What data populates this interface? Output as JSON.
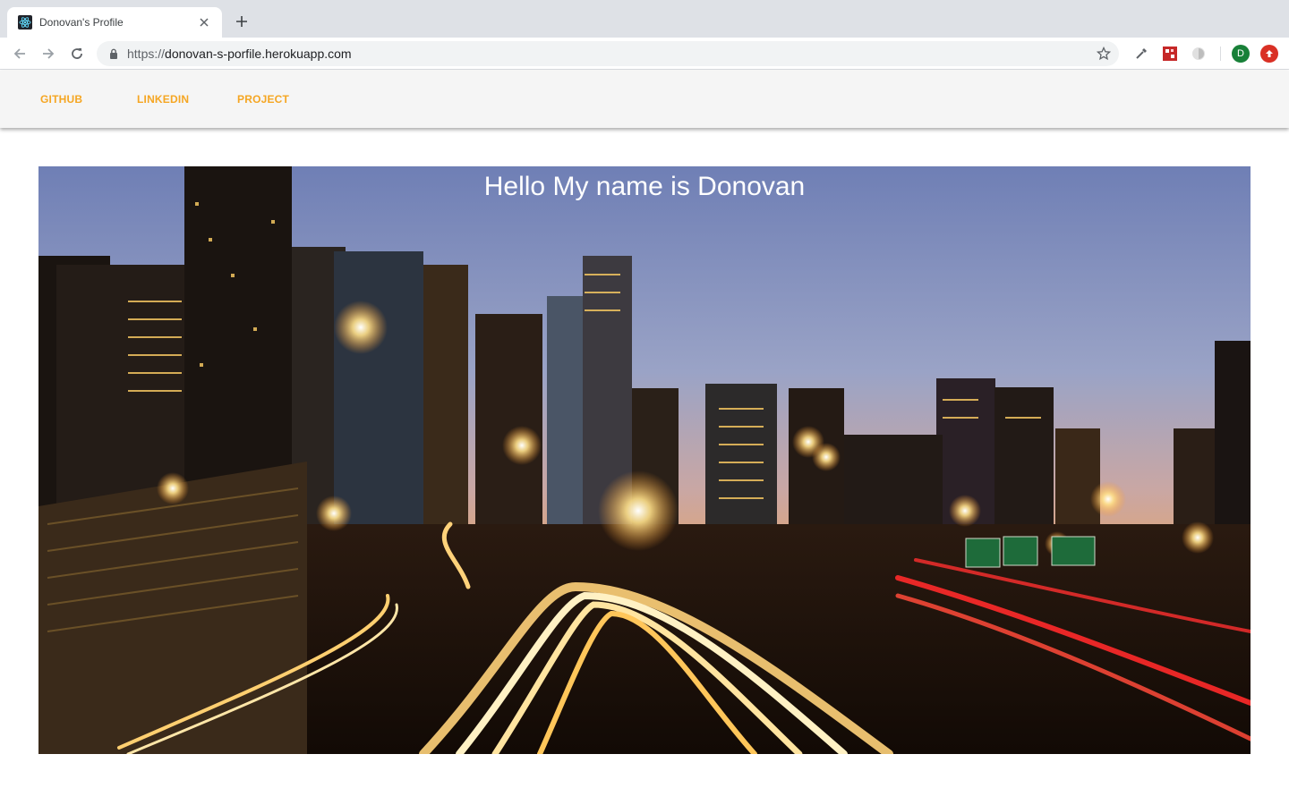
{
  "browser": {
    "tab_title": "Donovan's Profile",
    "url_scheme": "https://",
    "url_host": "donovan-s-porfile.herokuapp.com",
    "profile_initial": "D"
  },
  "nav": {
    "links": [
      "GITHUB",
      "LINKEDIN",
      "PROJECT"
    ],
    "link_color": "#f5a623"
  },
  "hero": {
    "title": "Hello My name is Donovan"
  },
  "icons": [
    "react-favicon-icon",
    "close-icon",
    "plus-icon",
    "back-icon",
    "forward-icon",
    "reload-icon",
    "lock-icon",
    "star-icon",
    "eyedropper-icon",
    "extension-icon",
    "extension-icon",
    "update-icon"
  ]
}
